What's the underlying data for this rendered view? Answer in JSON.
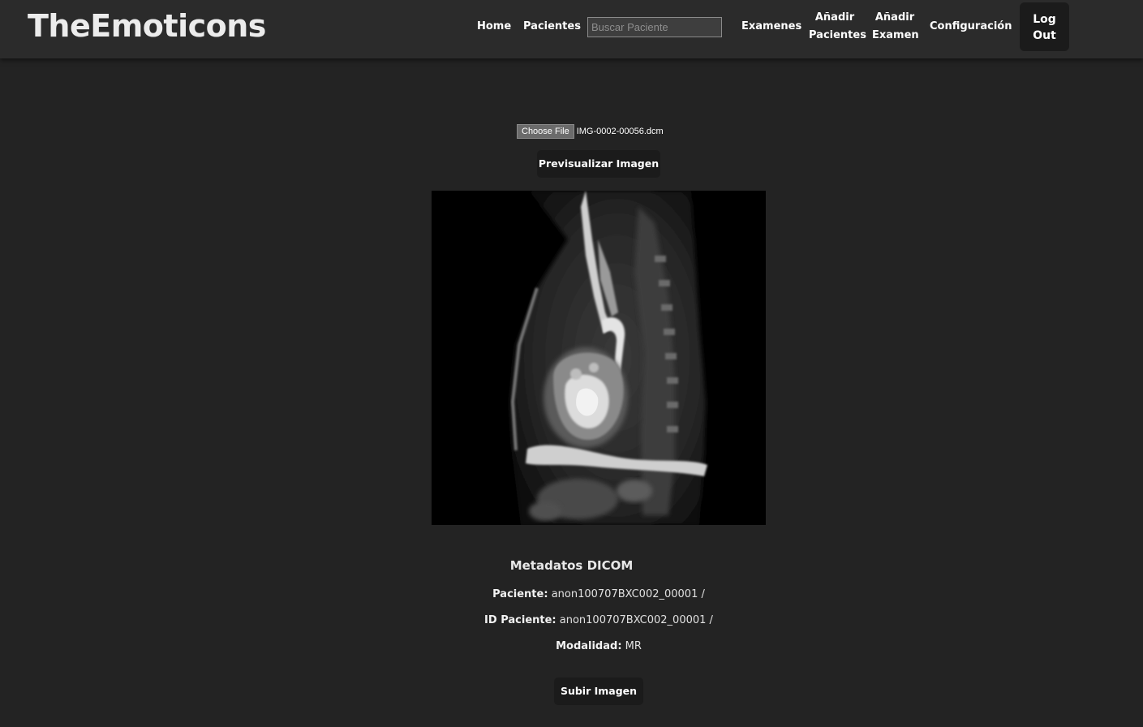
{
  "app": {
    "brand": "TheEmoticons"
  },
  "nav": {
    "home": "Home",
    "patients": "Pacientes",
    "search_placeholder": "Buscar Paciente",
    "exams": "Examenes",
    "add_patients_line1": "Añadir",
    "add_patients_line2": "Pacientes",
    "add_exam_line1": "Añadir",
    "add_exam_line2": "Examen",
    "settings": "Configuración",
    "logout_line1": "Log",
    "logout_line2": "Out"
  },
  "upload": {
    "choose_file_label": "Choose File",
    "file_name": "IMG-0002-00056.dcm",
    "preview_button": "Previsualizar Imagen",
    "submit_button": "Subir Imagen"
  },
  "metadata": {
    "title": "Metadatos DICOM",
    "patient_label": "Paciente:",
    "patient_value": "anon100707BXC002_00001 /",
    "patient_id_label": "ID Paciente:",
    "patient_id_value": "anon100707BXC002_00001 /",
    "modality_label": "Modalidad:",
    "modality_value": "MR"
  },
  "colors": {
    "background": "#232323",
    "navbar": "#2b2b2b",
    "button": "#1b1b1b"
  }
}
